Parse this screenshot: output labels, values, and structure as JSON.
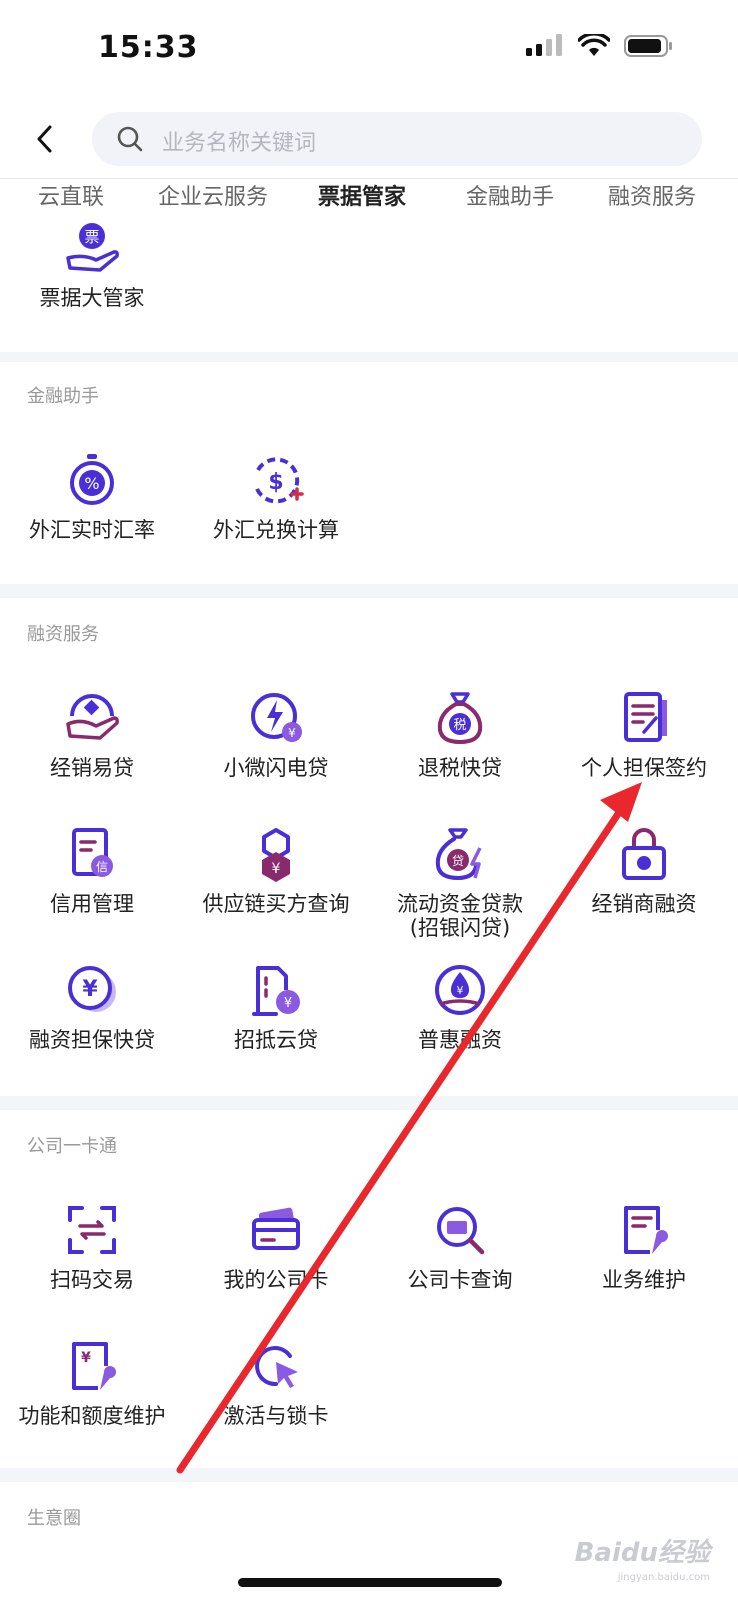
{
  "status": {
    "time": "15:33"
  },
  "search": {
    "placeholder": "业务名称关键词"
  },
  "tabs": [
    "云直联",
    "企业云服务",
    "票据管家",
    "金融助手",
    "融资服务"
  ],
  "sections": {
    "bill": {
      "items": [
        "票据大管家"
      ]
    },
    "finance_helper": {
      "title": "金融助手",
      "items": [
        "外汇实时汇率",
        "外汇兑换计算"
      ]
    },
    "financing": {
      "title": "融资服务",
      "items": [
        "经销易贷",
        "小微闪电贷",
        "退税快贷",
        "个人担保签约",
        "信用管理",
        "供应链买方查询",
        "流动资金贷款",
        "(招银闪贷)",
        "经销商融资",
        "融资担保快贷",
        "招抵云贷",
        "普惠融资"
      ]
    },
    "company_card": {
      "title": "公司一卡通",
      "items": [
        "扫码交易",
        "我的公司卡",
        "公司卡查询",
        "业务维护",
        "功能和额度维护",
        "激活与锁卡"
      ]
    },
    "business_circle": {
      "title": "生意圈"
    }
  },
  "icon_badges": {
    "bill": "票",
    "tax": "税",
    "credit": "信",
    "loan": "贷",
    "yuan": "¥",
    "percent": "%",
    "dollar": "$"
  },
  "watermark": {
    "brand": "Baidu经验",
    "url": "jingyan.baidu.com"
  },
  "colors": {
    "accent": "#4a2fd6",
    "accent2": "#8a2a6e",
    "arrow": "#e8282c"
  }
}
